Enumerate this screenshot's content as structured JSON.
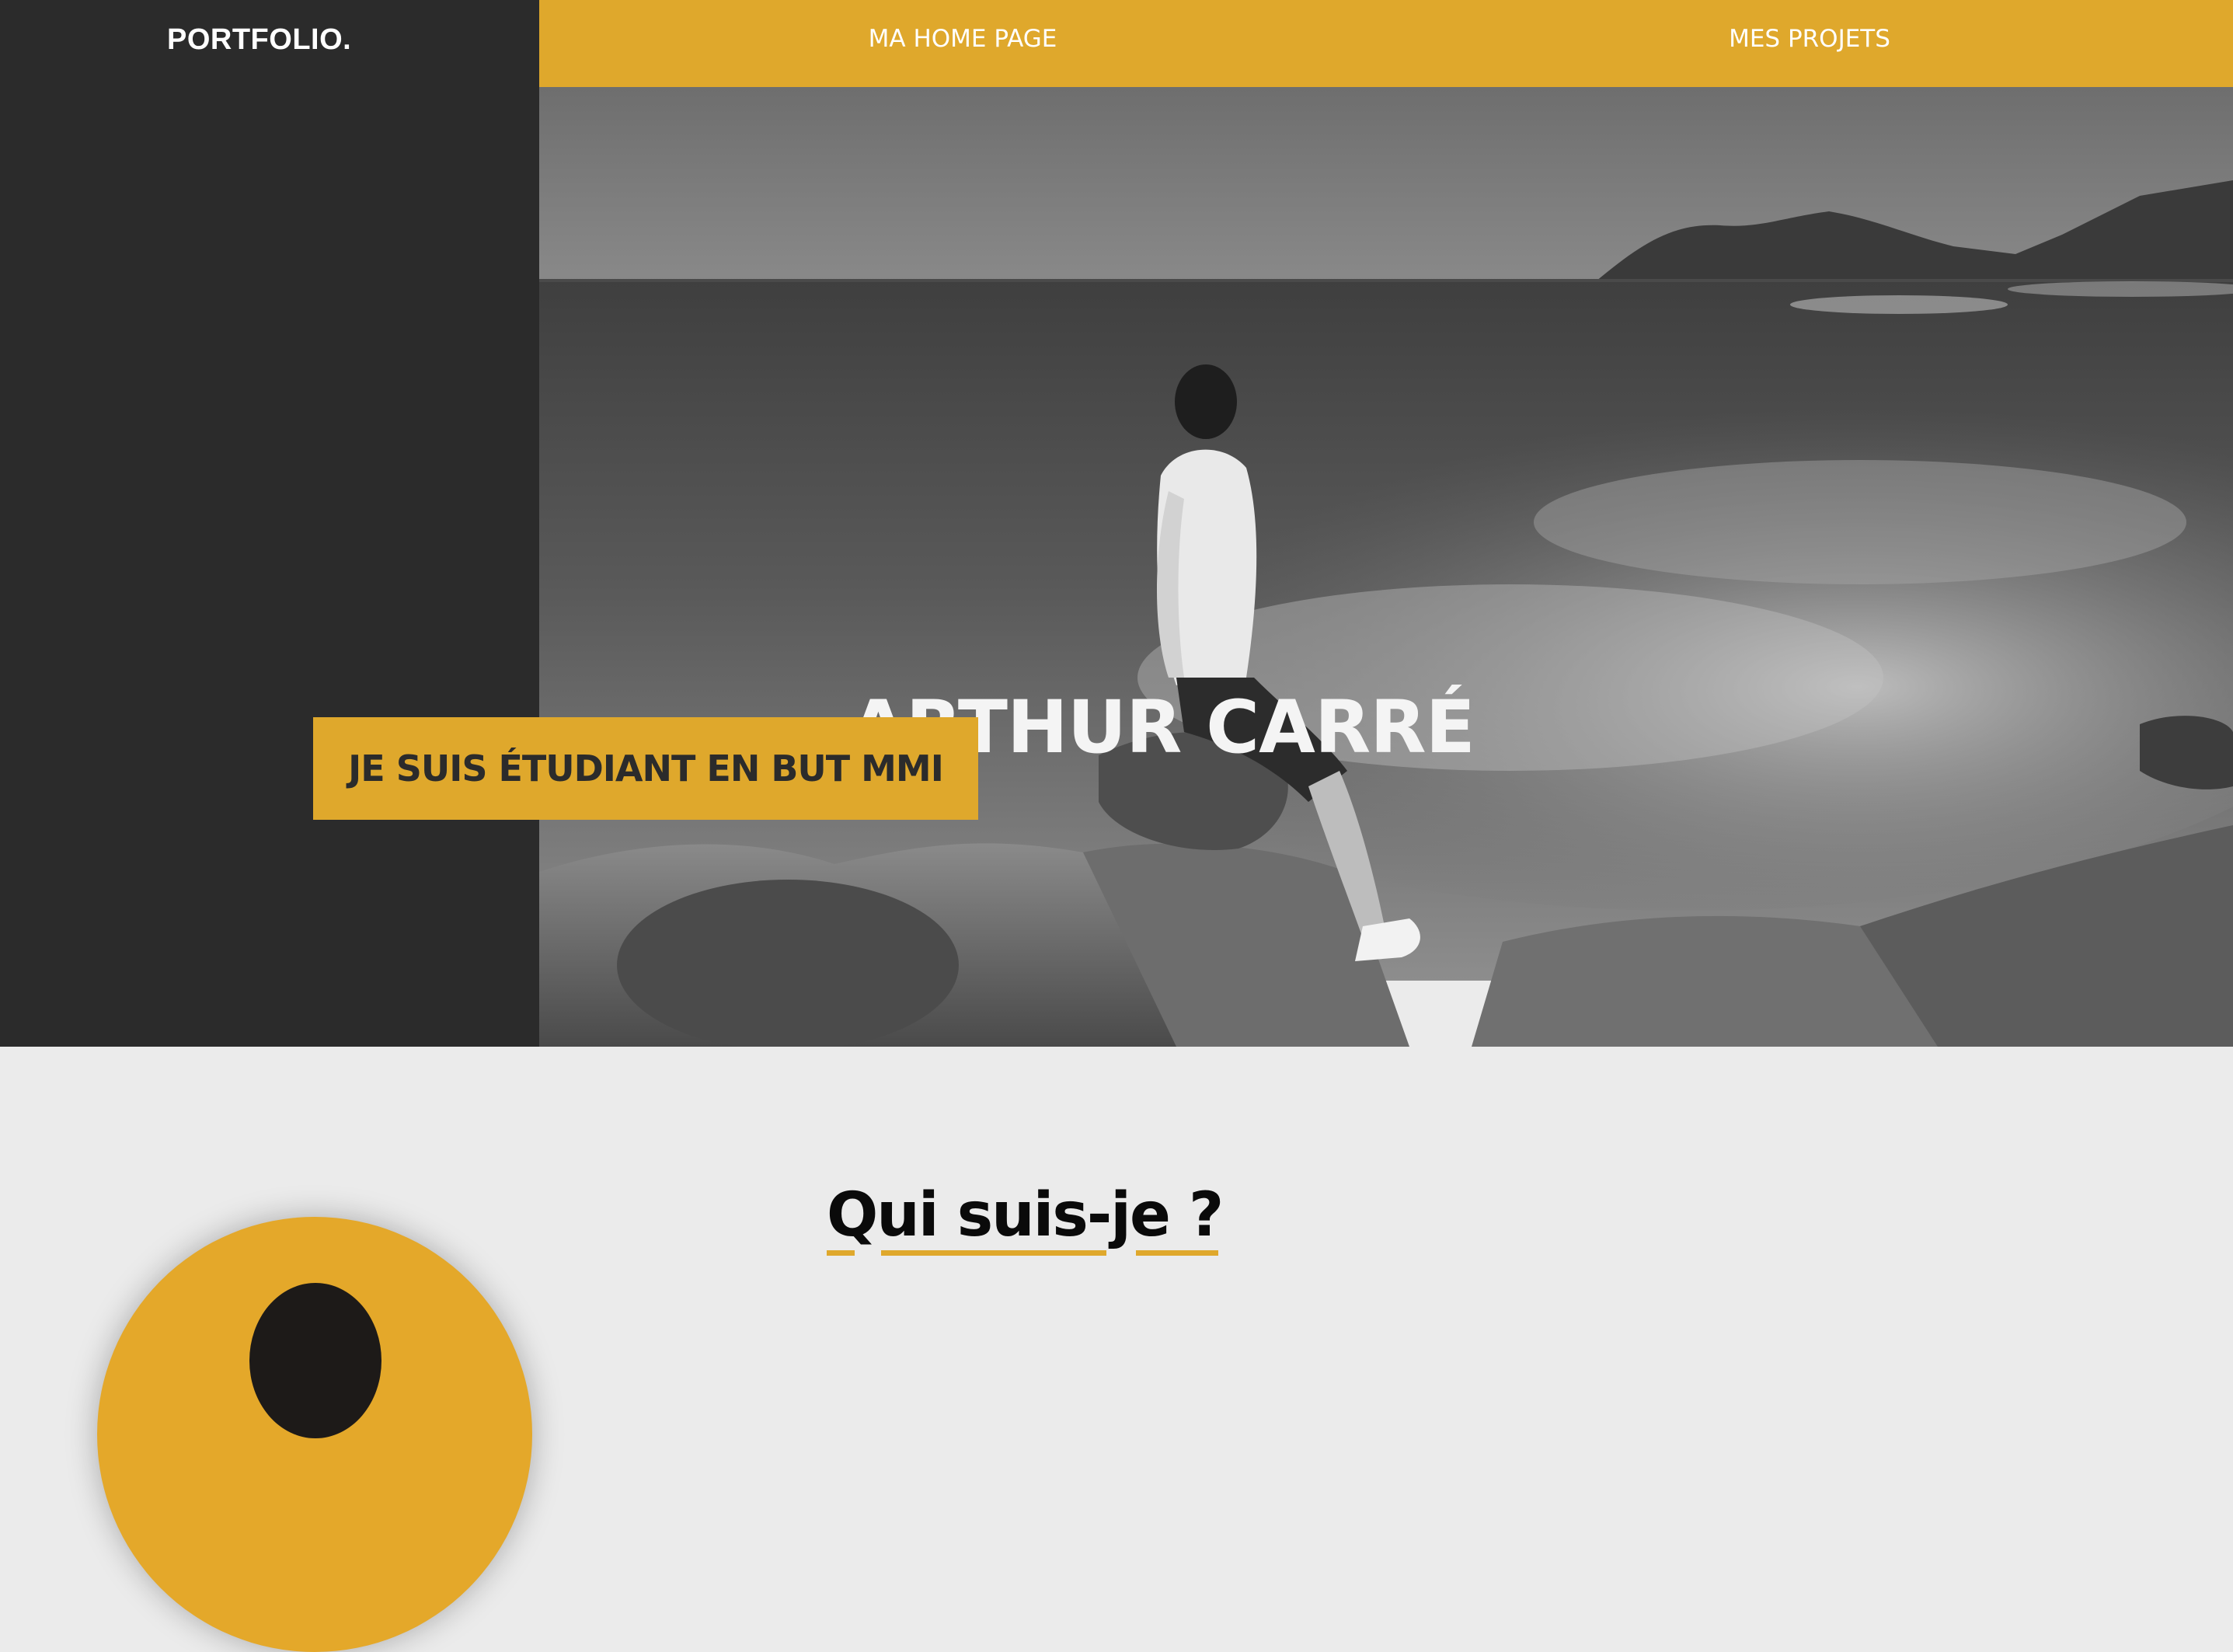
{
  "header": {
    "logo": "PORTFOLIO.",
    "nav": [
      {
        "label": "MA HOME PAGE"
      },
      {
        "label": "MES PROJETS"
      }
    ]
  },
  "hero": {
    "name": "ARTHUR CARRÉ",
    "tagline": "JE SUIS ÉTUDIANT EN BUT MMI"
  },
  "about": {
    "title": "Qui suis-je ?"
  },
  "colors": {
    "accent": "#dfa82c",
    "dark": "#2b2b2b",
    "light_bg": "#ebebeb"
  }
}
